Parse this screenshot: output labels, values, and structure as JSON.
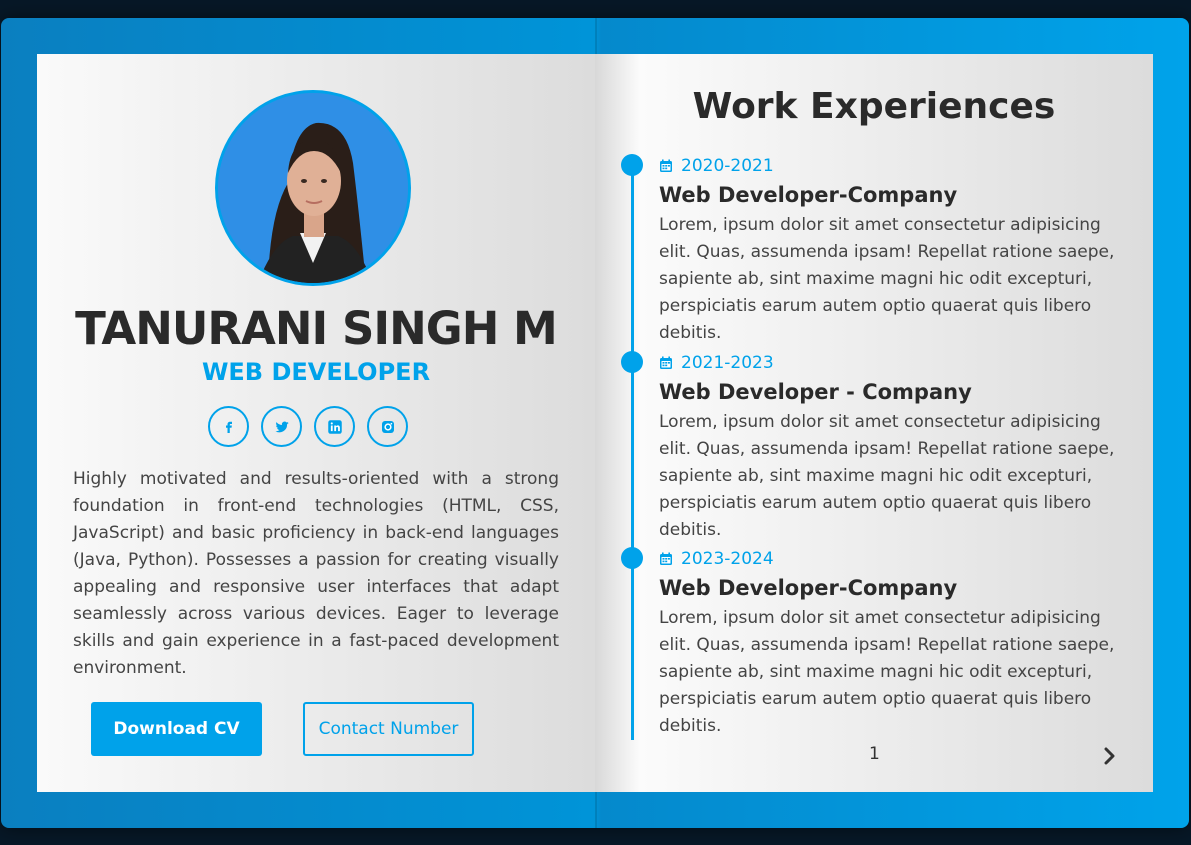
{
  "profile": {
    "name": "TANURANI SINGH M",
    "role": "WEB DEVELOPER",
    "bio": "Highly motivated and results-oriented with a strong foundation in front-end technologies (HTML, CSS, JavaScript) and basic proficiency in back-end languages (Java, Python). Possesses a passion for creating visually appealing and responsive user interfaces that adapt seamlessly across various devices. Eager to leverage skills and gain experience in a fast-paced development environment.",
    "socials": [
      {
        "icon": "facebook-icon"
      },
      {
        "icon": "twitter-icon"
      },
      {
        "icon": "linkedin-icon"
      },
      {
        "icon": "instagram-icon"
      }
    ],
    "buttons": {
      "download_label": "Download CV",
      "contact_label": "Contact Number"
    }
  },
  "experience": {
    "title": "Work Experiences",
    "items": [
      {
        "date": "2020-2021",
        "position": "Web Developer-Company",
        "description": "Lorem, ipsum dolor sit amet consectetur adipisicing elit. Quas, assumenda ipsam! Repellat ratione saepe, sapiente ab, sint maxime magni hic odit excepturi, perspiciatis earum autem optio quaerat quis libero debitis."
      },
      {
        "date": "2021-2023",
        "position": "Web Developer - Company",
        "description": "Lorem, ipsum dolor sit amet consectetur adipisicing elit. Quas, assumenda ipsam! Repellat ratione saepe, sapiente ab, sint maxime magni hic odit excepturi, perspiciatis earum autem optio quaerat quis libero debitis."
      },
      {
        "date": "2023-2024",
        "position": "Web Developer-Company",
        "description": "Lorem, ipsum dolor sit amet consectetur adipisicing elit. Quas, assumenda ipsam! Repellat ratione saepe, sapiente ab, sint maxime magni hic odit excepturi, perspiciatis earum autem optio quaerat quis libero debitis."
      }
    ]
  },
  "pagination": {
    "page": "1"
  },
  "colors": {
    "accent": "#00a2ea",
    "text_dark": "#2a2a2a",
    "background": "#071827"
  }
}
